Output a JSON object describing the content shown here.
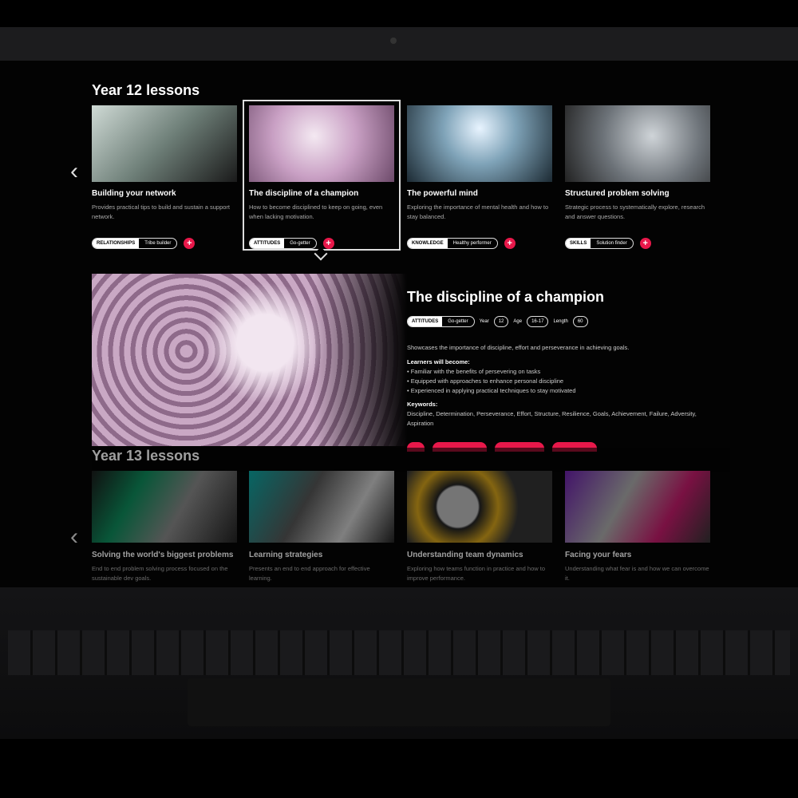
{
  "year12": {
    "heading": "Year 12 lessons",
    "cards": [
      {
        "title": "Building your network",
        "desc": "Provides practical tips to build and sustain a support network.",
        "category": "RELATIONSHIPS",
        "tag": "Tribe builder"
      },
      {
        "title": "The discipline of a champion",
        "desc": "How to become disciplined to keep on going, even when lacking motivation.",
        "category": "ATTITUDES",
        "tag": "Go-getter"
      },
      {
        "title": "The powerful mind",
        "desc": "Exploring the importance of mental health and how to stay balanced.",
        "category": "KNOWLEDGE",
        "tag": "Healthy performer"
      },
      {
        "title": "Structured problem solving",
        "desc": "Strategic process to systematically explore, research and answer questions.",
        "category": "SKILLS",
        "tag": "Solution finder"
      }
    ]
  },
  "plus": "+",
  "arrows": {
    "prev": "‹",
    "next": "›"
  },
  "detail": {
    "title": "The discipline of a champion",
    "category": "ATTITUDES",
    "tag": "Go-getter",
    "year_label": "Year",
    "year": "12",
    "age_label": "Age",
    "age": "16-17",
    "length_label": "Length",
    "length": "60",
    "summary": "Showcases the importance of discipline, effort and perseverance in achieving goals.",
    "learners_heading": "Learners will become:",
    "learners": [
      "Familiar with the benefits of persevering on tasks",
      "Equipped with approaches to enhance personal discipline",
      "Experienced in applying practical techniques to stay motivated"
    ],
    "keywords_heading": "Keywords:",
    "keywords": "Discipline, Determination, Perseverance, Effort, Structure, Resilience, Goals, Achievement, Failure, Adversity, Aspiration"
  },
  "year13": {
    "heading": "Year 13 lessons",
    "cards": [
      {
        "title": "Solving the world's biggest problems",
        "desc": "End to end problem solving process focused on the sustainable dev goals."
      },
      {
        "title": "Learning strategies",
        "desc": "Presents an end to end approach for effective learning."
      },
      {
        "title": "Understanding team dynamics",
        "desc": "Exploring how teams function in practice and how to improve performance."
      },
      {
        "title": "Facing your fears",
        "desc": "Understanding what fear is and how we can overcome it."
      }
    ]
  },
  "colors": {
    "accent": "#e8184a",
    "background": "#030303"
  }
}
